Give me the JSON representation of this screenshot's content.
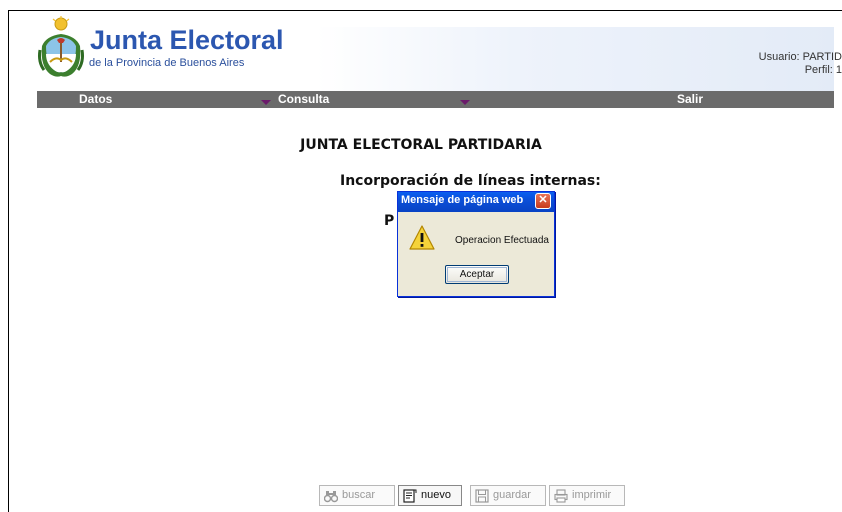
{
  "header": {
    "title": "Junta Electoral",
    "subtitle": "de la Provincia de Buenos Aires",
    "user_label": "Usuario: PARTID",
    "profile_label": "Perfil: 1"
  },
  "menu": {
    "items": [
      {
        "label": "Datos"
      },
      {
        "label": "Consulta"
      },
      {
        "label": "Salir"
      }
    ]
  },
  "content": {
    "title": "JUNTA ELECTORAL PARTIDARIA",
    "subtitle": "Incorporación de líneas internas:",
    "partial_label": "P"
  },
  "dialog": {
    "title": "Mensaje de página web",
    "message": "Operacion Efectuada",
    "button": "Aceptar",
    "icon": "warning-icon"
  },
  "toolbar": {
    "buttons": [
      {
        "label": "buscar",
        "icon": "binoculars-icon",
        "enabled": false
      },
      {
        "label": "nuevo",
        "icon": "new-document-icon",
        "enabled": true
      },
      {
        "label": "guardar",
        "icon": "save-icon",
        "enabled": false
      },
      {
        "label": "imprimir",
        "icon": "printer-icon",
        "enabled": false
      }
    ]
  },
  "colors": {
    "brand_blue": "#2c57b0",
    "menubar": "#6b6b6b",
    "dialog_title": "#0b4fd8",
    "dialog_bg": "#ece9d8"
  }
}
